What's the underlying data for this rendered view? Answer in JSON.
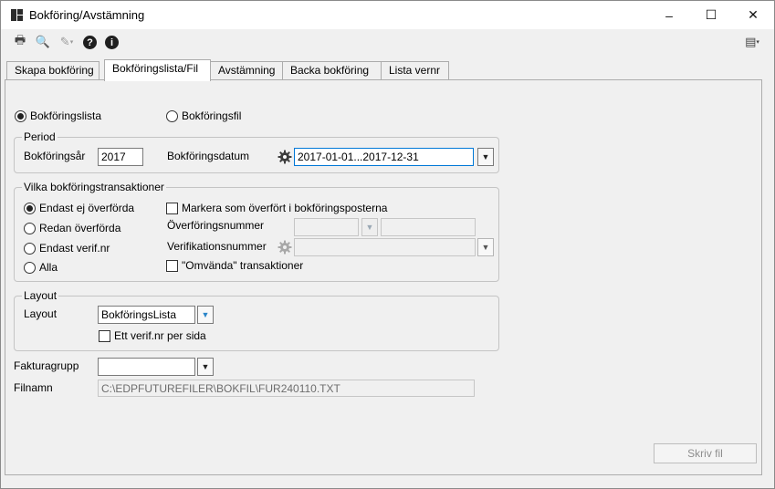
{
  "window": {
    "title": "Bokföring/Avstämning",
    "minimize": "–",
    "maximize": "☐",
    "close": "✕"
  },
  "toolbar": {
    "print": "🖶",
    "preview": "🔍",
    "spell": "✎",
    "help": "?",
    "info": "i",
    "options": "▤"
  },
  "tabs": [
    "Skapa bokföring",
    "Bokföringslista/Fil",
    "Avstämning",
    "Backa bokföring",
    "Lista vernr"
  ],
  "mode": {
    "list_label": "Bokföringslista",
    "file_label": "Bokföringsfil"
  },
  "period": {
    "legend": "Period",
    "year_label": "Bokföringsår",
    "year_value": "2017",
    "date_label": "Bokföringsdatum",
    "date_value": "2017-01-01...2017-12-31"
  },
  "transactions": {
    "legend": "Vilka bokföringstransaktioner",
    "options": [
      "Endast ej överförda",
      "Redan överförda",
      "Endast verif.nr",
      "Alla"
    ],
    "mark_label": "Markera som överfört i bokföringsposterna",
    "transfer_number_label": "Överföringsnummer",
    "verification_number_label": "Verifikationsnummer",
    "reversed_label": "\"Omvända\" transaktioner"
  },
  "layout": {
    "legend": "Layout",
    "layout_label": "Layout",
    "layout_value": "BokföringsLista",
    "one_per_page_label": "Ett verif.nr per sida"
  },
  "invoice_group_label": "Fakturagrupp",
  "invoice_group_value": "",
  "filename_label": "Filnamn",
  "filename_value": "C:\\EDPFUTUREFILER\\BOKFIL\\FUR240110.TXT",
  "write_button": "Skriv fil"
}
